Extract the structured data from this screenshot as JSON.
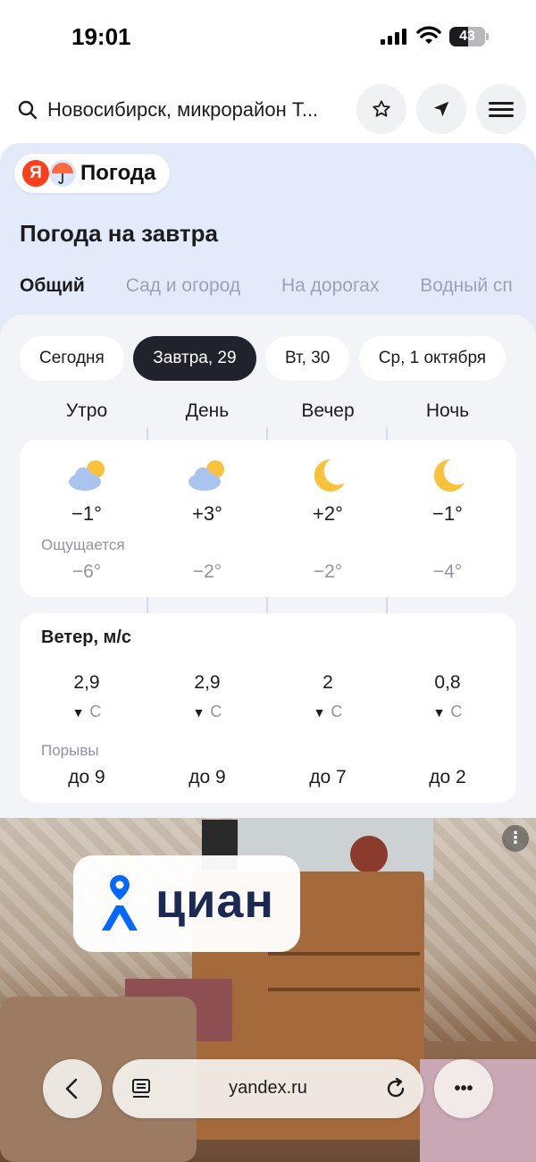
{
  "status_bar": {
    "time": "19:01",
    "battery": "43",
    "icons": [
      "signal-icon",
      "wifi-icon",
      "battery-icon"
    ]
  },
  "search": {
    "value": "Новосибирск, микрорайон Т...",
    "icon": "search-icon"
  },
  "header_buttons": [
    "star-icon",
    "location-arrow-icon",
    "menu-icon"
  ],
  "logo": {
    "ya": "Я",
    "text": "Погода"
  },
  "page_title": "Погода на завтра",
  "tabs": [
    {
      "label": "Общий",
      "active": true
    },
    {
      "label": "Сад и огород",
      "active": false
    },
    {
      "label": "На дорогах",
      "active": false
    },
    {
      "label": "Водный сп",
      "active": false
    }
  ],
  "days": [
    {
      "label": "Сегодня",
      "active": false
    },
    {
      "label": "Завтра, 29",
      "active": true
    },
    {
      "label": "Вт, 30",
      "active": false
    },
    {
      "label": "Ср, 1 октября",
      "active": false
    }
  ],
  "periods": [
    {
      "name": "Утро",
      "icon": "partly-cloudy-icon",
      "temp": "−1°",
      "feels": "−6°",
      "wind_speed": "2,9",
      "wind_dir": "С",
      "gust": "до 9"
    },
    {
      "name": "День",
      "icon": "partly-cloudy-icon",
      "temp": "+3°",
      "feels": "−2°",
      "wind_speed": "2,9",
      "wind_dir": "С",
      "gust": "до 9"
    },
    {
      "name": "Вечер",
      "icon": "moon-icon",
      "temp": "+2°",
      "feels": "−2°",
      "wind_speed": "2",
      "wind_dir": "С",
      "gust": "до 7"
    },
    {
      "name": "Ночь",
      "icon": "moon-icon",
      "temp": "−1°",
      "feels": "−4°",
      "wind_speed": "0,8",
      "wind_dir": "С",
      "gust": "до 2"
    }
  ],
  "labels": {
    "feels_like": "Ощущается",
    "wind": "Ветер, м/с",
    "gusts": "Порывы",
    "wind_arrow": "▼"
  },
  "ad": {
    "brand": "циан",
    "more": "⋮"
  },
  "browser": {
    "url": "yandex.ru",
    "more": "•••"
  },
  "colors": {
    "header_bg": "#e3ebfa",
    "active_chip": "#20232b",
    "yandex_red": "#fc3f1d",
    "sun": "#f9c23c",
    "cloud": "#a9c4ee",
    "cian_blue": "#0468ff"
  }
}
